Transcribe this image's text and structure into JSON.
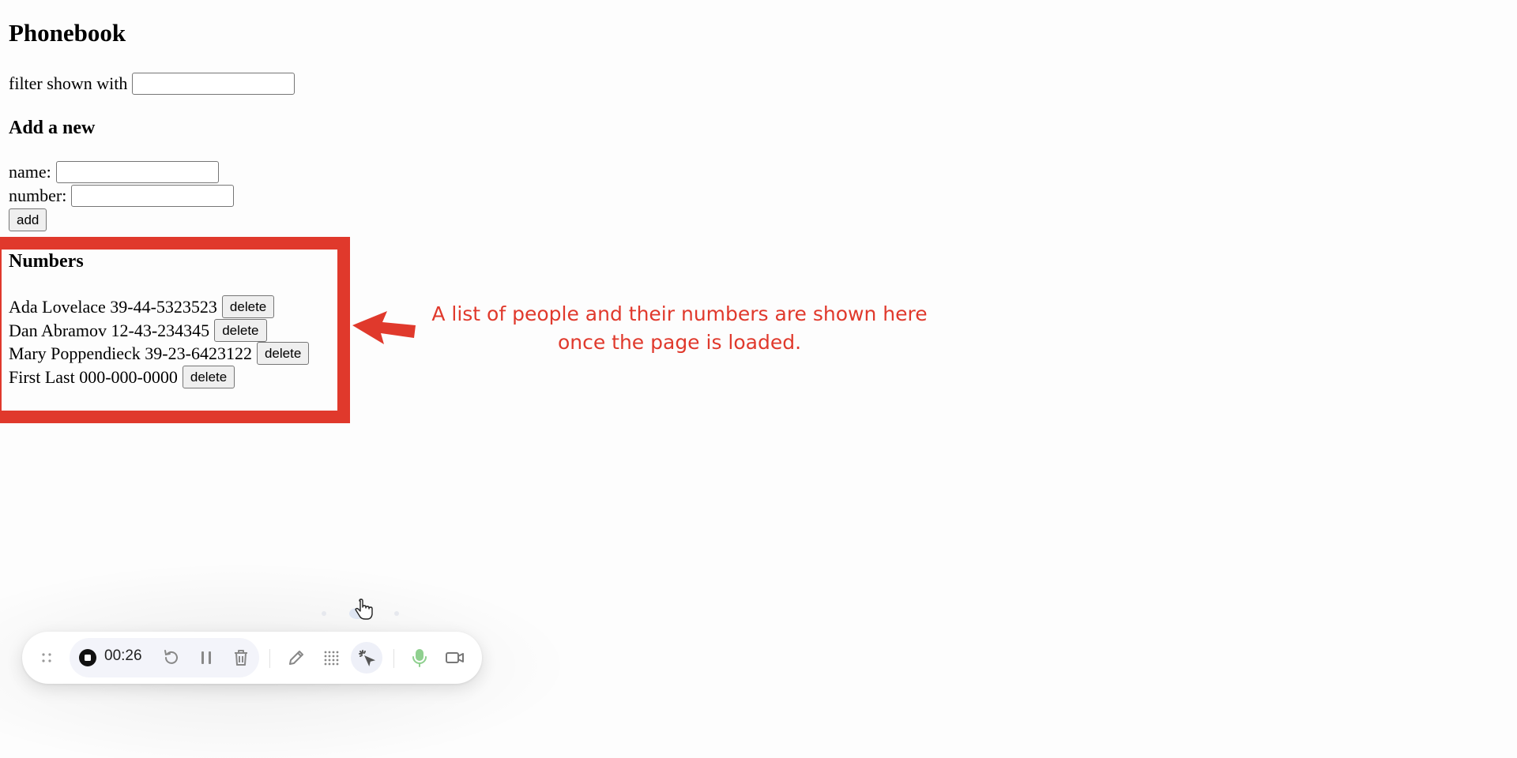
{
  "page": {
    "title": "Phonebook",
    "filter_label": "filter shown with",
    "filter_value": "",
    "add_heading": "Add a new",
    "name_label": "name:",
    "name_value": "",
    "number_label": "number:",
    "number_value": "",
    "add_button": "add",
    "numbers_heading": "Numbers",
    "persons": [
      {
        "text": "Ada Lovelace 39-44-5323523",
        "button": "delete"
      },
      {
        "text": "Dan Abramov 12-43-234345",
        "button": "delete"
      },
      {
        "text": "Mary Poppendieck 39-23-6423122",
        "button": "delete"
      },
      {
        "text": "First Last 000-000-0000",
        "button": "delete"
      }
    ]
  },
  "annotation": {
    "line1": "A list of people and their numbers are shown here",
    "line2": "once the page is loaded.",
    "color": "#e0392c"
  },
  "recorder": {
    "timer": "00:26",
    "icons": [
      "drag-handle-icon",
      "stop-icon",
      "restart-icon",
      "pause-icon",
      "trash-icon",
      "pen-icon",
      "grid-icon",
      "cursor-highlight-icon",
      "microphone-icon",
      "camera-icon"
    ],
    "mic_color": "#8fd08f"
  }
}
